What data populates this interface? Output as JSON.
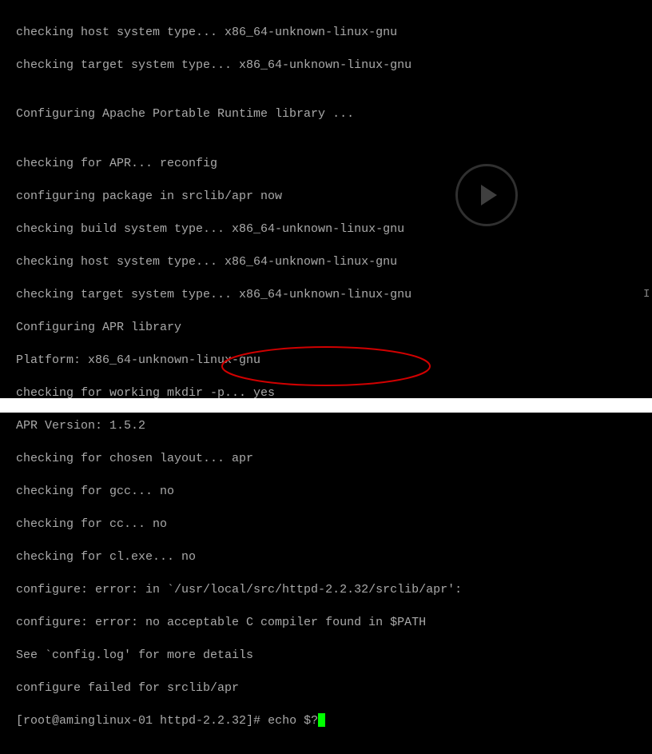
{
  "lines": [
    "checking host system type... x86_64-unknown-linux-gnu",
    "checking target system type... x86_64-unknown-linux-gnu",
    "",
    "Configuring Apache Portable Runtime library ...",
    "",
    "checking for APR... reconfig",
    "configuring package in srclib/apr now",
    "checking build system type... x86_64-unknown-linux-gnu",
    "checking host system type... x86_64-unknown-linux-gnu",
    "checking target system type... x86_64-unknown-linux-gnu",
    "Configuring APR library",
    "Platform: x86_64-unknown-linux-gnu",
    "checking for working mkdir -p... yes",
    "APR Version: 1.5.2",
    "checking for chosen layout... apr",
    "checking for gcc... no",
    "checking for cc... no",
    "checking for cl.exe... no",
    "configure: error: in `/usr/local/src/httpd-2.2.32/srclib/apr':",
    "configure: error: no acceptable C compiler found in $PATH",
    "See `config.log' for more details",
    "configure failed for srclib/apr"
  ],
  "prompt": {
    "prefix": "[root@aminglinux-01 httpd-2.2.32]# ",
    "command": "echo $?"
  }
}
